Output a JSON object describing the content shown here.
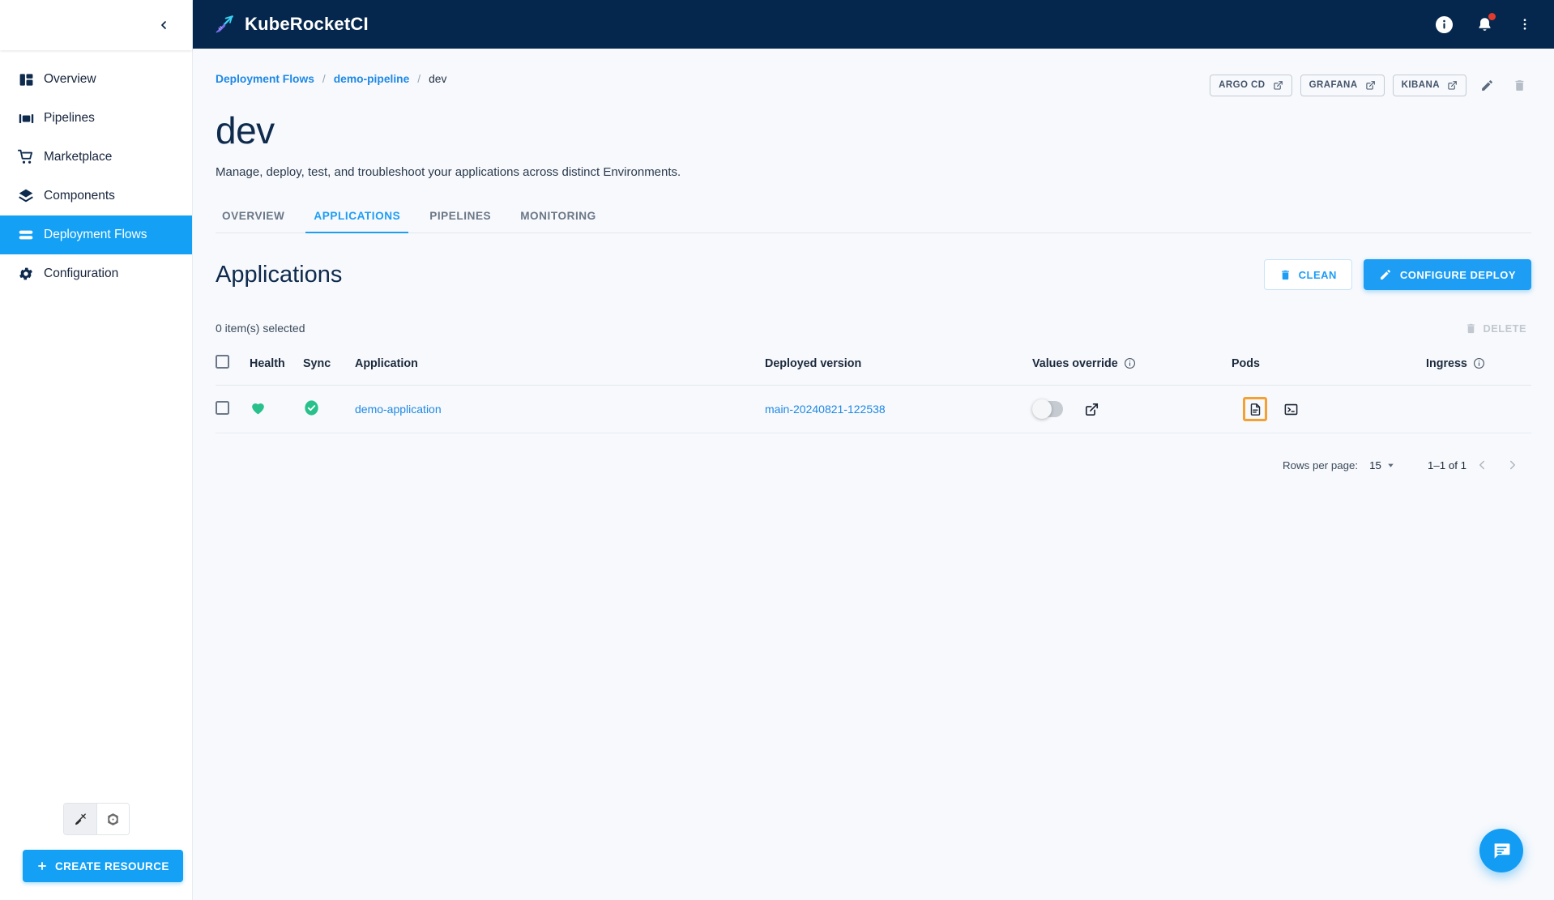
{
  "sidebar": {
    "collapse_icon": "chevron-left-icon",
    "items": [
      {
        "label": "Overview",
        "icon": "dashboard-icon",
        "active": false
      },
      {
        "label": "Pipelines",
        "icon": "pipelines-icon",
        "active": false
      },
      {
        "label": "Marketplace",
        "icon": "cart-icon",
        "active": false
      },
      {
        "label": "Components",
        "icon": "layers-icon",
        "active": false
      },
      {
        "label": "Deployment Flows",
        "icon": "flows-icon",
        "active": true
      },
      {
        "label": "Configuration",
        "icon": "gear-icon",
        "active": false
      }
    ],
    "view_toggle": [
      {
        "icon": "kuberocket-icon",
        "selected": true
      },
      {
        "icon": "kubernetes-icon",
        "selected": false
      }
    ],
    "create_resource_label": "CREATE RESOURCE",
    "create_resource_icon": "plus-icon",
    "accent": "#13a0f5"
  },
  "topbar": {
    "brand": "KubeRocketCI",
    "brand_icon": "rocket-pen-icon",
    "background": "#05274d",
    "icons": [
      {
        "name": "info-icon"
      },
      {
        "name": "bell-icon",
        "badge": true,
        "badge_color": "#e23b2e"
      },
      {
        "name": "more-vertical-icon"
      }
    ]
  },
  "breadcrumb": {
    "items": [
      {
        "label": "Deployment Flows",
        "link": true
      },
      {
        "label": "demo-pipeline",
        "link": true
      },
      {
        "label": "dev",
        "link": false
      }
    ],
    "separator": "/"
  },
  "header_actions": {
    "buttons": [
      {
        "label": "ARGO CD",
        "icon": "external-link-icon"
      },
      {
        "label": "GRAFANA",
        "icon": "external-link-icon"
      },
      {
        "label": "KIBANA",
        "icon": "external-link-icon"
      }
    ],
    "edit_icon": "pencil-icon",
    "delete_icon": "trash-icon"
  },
  "page": {
    "title": "dev",
    "subtitle": "Manage, deploy, test, and troubleshoot your applications across distinct Environments."
  },
  "tabs": [
    {
      "label": "OVERVIEW",
      "active": false
    },
    {
      "label": "APPLICATIONS",
      "active": true
    },
    {
      "label": "PIPELINES",
      "active": false
    },
    {
      "label": "MONITORING",
      "active": false
    }
  ],
  "section": {
    "title": "Applications",
    "clean_label": "CLEAN",
    "clean_icon": "trash-icon",
    "configure_deploy_label": "CONFIGURE DEPLOY",
    "configure_deploy_icon": "pencil-icon"
  },
  "selection": {
    "count_text": "0 item(s) selected",
    "delete_label": "DELETE",
    "delete_icon": "trash-icon"
  },
  "table": {
    "columns": [
      {
        "key": "checkbox",
        "label": "",
        "info": false
      },
      {
        "key": "health",
        "label": "Health",
        "info": false
      },
      {
        "key": "sync",
        "label": "Sync",
        "info": false
      },
      {
        "key": "application",
        "label": "Application",
        "info": false
      },
      {
        "key": "deployed_version",
        "label": "Deployed version",
        "info": false
      },
      {
        "key": "values_override",
        "label": "Values override",
        "info": true
      },
      {
        "key": "pods",
        "label": "Pods",
        "info": false
      },
      {
        "key": "ingress",
        "label": "Ingress",
        "info": true
      }
    ],
    "rows": [
      {
        "selected": false,
        "health": {
          "icon": "heart-icon",
          "color": "#28c18b"
        },
        "sync": {
          "icon": "check-circle-icon",
          "color": "#28c18b"
        },
        "application": "demo-application",
        "deployed_version": "main-20240821-122538",
        "values_override": {
          "enabled": false
        },
        "values_override_link_icon": "external-link-icon",
        "pods": [
          {
            "icon": "file-document-icon",
            "highlighted": true,
            "highlight_color": "#f5a033"
          },
          {
            "icon": "terminal-icon",
            "highlighted": false
          }
        ],
        "ingress": ""
      }
    ]
  },
  "pagination": {
    "rows_per_page_label": "Rows per page:",
    "rows_per_page_value": "15",
    "range_label": "1–1 of 1",
    "prev_icon": "chevron-left-icon",
    "next_icon": "chevron-right-icon"
  },
  "fab": {
    "icon": "chat-icon",
    "color": "#139cf3"
  }
}
